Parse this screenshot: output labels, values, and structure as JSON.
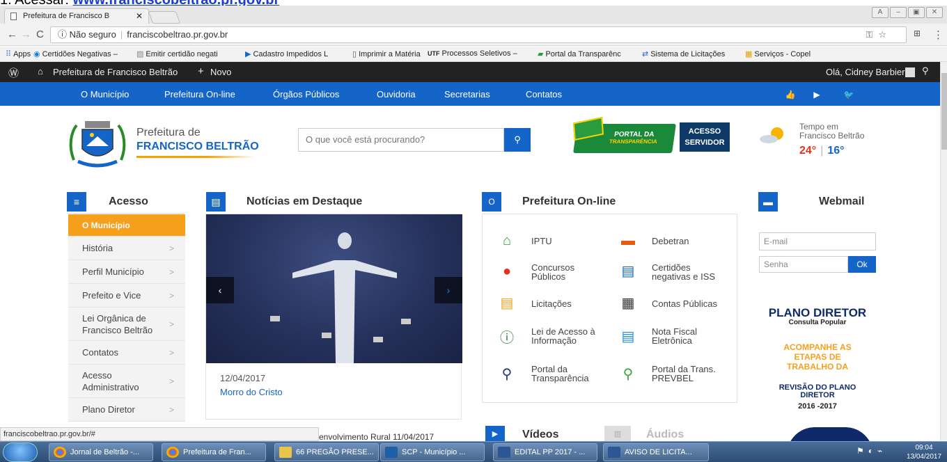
{
  "doc_heading": {
    "prefix": "1. Acessar:",
    "link": "www.franciscobeltrao.pr.gov.br"
  },
  "browser": {
    "tab_title": "Prefeitura de Francisco B",
    "security": "Não seguro",
    "url": "franciscobeltrao.pr.gov.br"
  },
  "bookmarks": [
    "Apps",
    "Certidões Negativas –",
    "Emitir certidão negati",
    "Cadastro Impedidos L",
    "Imprimir a Matéria",
    "Processos Seletivos –",
    "Portal da Transparênc",
    "Sistema de Licitações",
    "Serviços - Copel"
  ],
  "wp_bar": {
    "site": "Prefeitura de Francisco Beltrão",
    "new": "Novo",
    "greeting": "Olá, Cidney Barbiero"
  },
  "nav": [
    "O Município",
    "Prefeitura On-line",
    "Órgãos Públicos",
    "Ouvidoria",
    "Secretarias",
    "Contatos"
  ],
  "brand": {
    "line1": "Prefeitura de",
    "line2": "FRANCISCO BELTRÃO"
  },
  "search": {
    "placeholder": "O que você está procurando?"
  },
  "portal": {
    "line1": "PORTAL DA",
    "line2": "TRANSPARÊNCIA"
  },
  "acesso_servidor": {
    "line1": "ACESSO",
    "line2": "SERVIDOR"
  },
  "weather": {
    "line1": "Tempo em",
    "line2": "Francisco Beltrão",
    "max": "24°",
    "min": "16°"
  },
  "sections": {
    "acesso": "Acesso",
    "noticias": "Notícias em Destaque",
    "online": "Prefeitura On-line",
    "webmail": "Webmail",
    "videos": "Vídeos",
    "audios": "Áudios"
  },
  "acesso_menu": [
    {
      "label": "O Município",
      "l2": ""
    },
    {
      "label": "História",
      "l2": ""
    },
    {
      "label": "Perfil Município",
      "l2": ""
    },
    {
      "label": "Prefeito e Vice",
      "l2": ""
    },
    {
      "label": "Lei Orgânica de",
      "l2": "Francisco Beltrão"
    },
    {
      "label": "Contatos",
      "l2": ""
    },
    {
      "label": "Acesso",
      "l2": "Administrativo"
    },
    {
      "label": "Plano Diretor",
      "l2": ""
    }
  ],
  "news": {
    "date": "12/04/2017",
    "caption": "Morro do Cristo"
  },
  "online_services": [
    {
      "l1": "IPTU",
      "l2": ""
    },
    {
      "l1": "Debetran",
      "l2": ""
    },
    {
      "l1": "Concursos",
      "l2": "Públicos"
    },
    {
      "l1": "Certidões",
      "l2": "negativas e ISS"
    },
    {
      "l1": "Licitações",
      "l2": ""
    },
    {
      "l1": "Contas Públicas",
      "l2": ""
    },
    {
      "l1": "Lei de Acesso à",
      "l2": "Informação"
    },
    {
      "l1": "Nota Fiscal",
      "l2": "Eletrônica"
    },
    {
      "l1": "Portal da",
      "l2": "Transparência"
    },
    {
      "l1": "Portal da Trans.",
      "l2": "PREVBEL"
    }
  ],
  "webmail": {
    "email_placeholder": "E-mail",
    "password_placeholder": "Senha",
    "ok": "Ok"
  },
  "plano": {
    "title": "PLANO DIRETOR",
    "sub": "Consulta Popular",
    "l1": "ACOMPANHE AS",
    "l2": "ETAPAS DE",
    "l3": "TRABALHO DA",
    "l4": "REVISÃO DO PLANO",
    "l5": "DIRETOR",
    "years": "2016 -2017"
  },
  "status_url": "franciscobeltrao.pr.gov.br/#",
  "behind_text": "envolvimento Rural   11/04/2017",
  "taskbar": [
    "Jornal de Beltrão -...",
    "Prefeitura de Fran...",
    "66 PREGÃO PRESE...",
    "SCP - Município ...",
    "EDITAL PP 2017 - ...",
    "AVISO DE LICITA..."
  ],
  "clock": {
    "time": "09:04",
    "date": "13/04/2017"
  },
  "colors": {
    "primary": "#1565c8",
    "accent": "#f7a01c",
    "wp_bar": "#222222"
  }
}
